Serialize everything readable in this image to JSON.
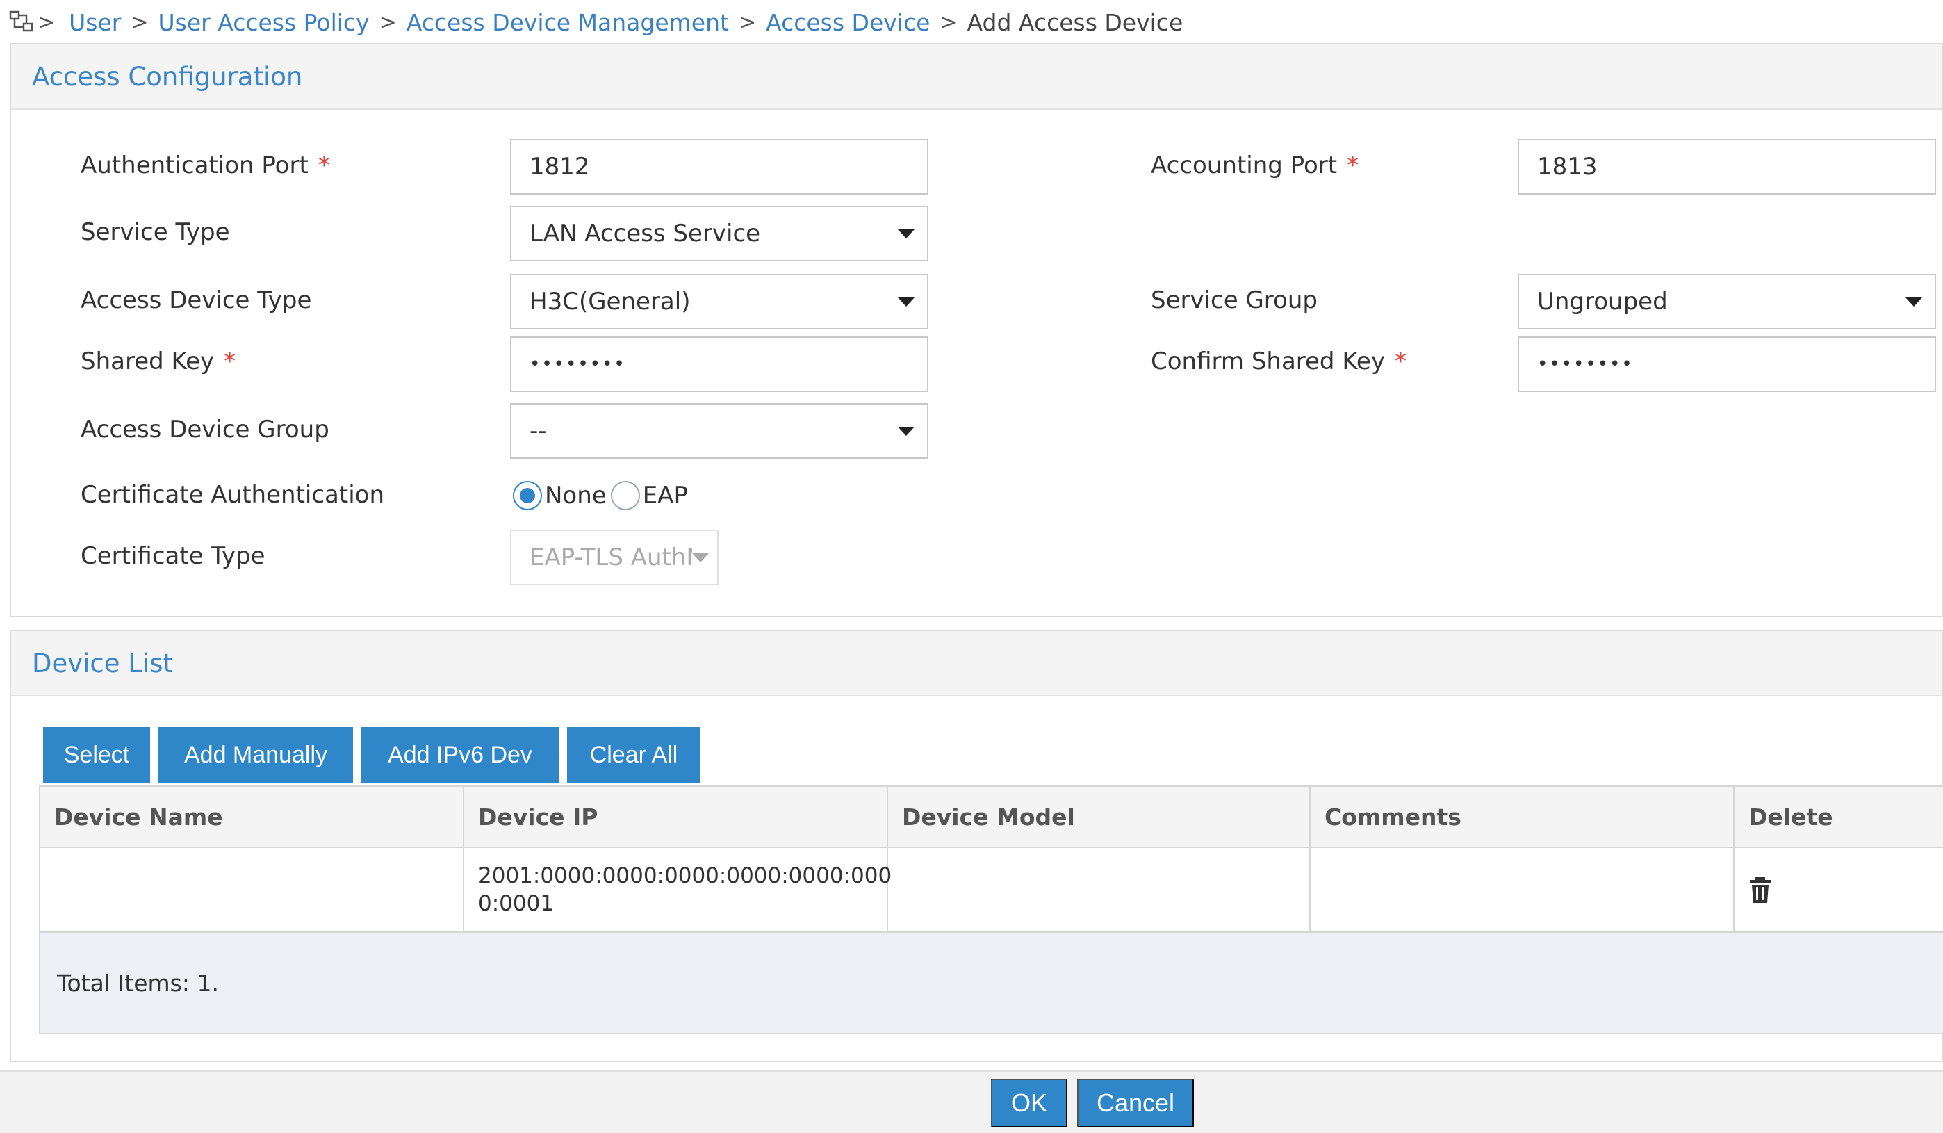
{
  "breadcrumb": {
    "items": [
      "User",
      "User Access Policy",
      "Access Device Management",
      "Access Device"
    ],
    "current": "Add Access Device",
    "separator": ">"
  },
  "access_config": {
    "title": "Access Configuration",
    "auth_port": {
      "label": "Authentication Port",
      "value": "1812",
      "required": "*"
    },
    "acct_port": {
      "label": "Accounting Port",
      "value": "1813",
      "required": "*"
    },
    "service_type": {
      "label": "Service Type",
      "value": "LAN Access Service"
    },
    "device_type": {
      "label": "Access Device Type",
      "value": "H3C(General)"
    },
    "service_group": {
      "label": "Service Group",
      "value": "Ungrouped"
    },
    "shared_key": {
      "label": "Shared Key",
      "value": "••••••••",
      "required": "*"
    },
    "confirm_key": {
      "label": "Confirm Shared Key",
      "value": "••••••••",
      "required": "*"
    },
    "device_group": {
      "label": "Access Device Group",
      "value": "--"
    },
    "cert_auth": {
      "label": "Certificate Authentication",
      "options": [
        "None",
        "EAP"
      ],
      "selected": "None"
    },
    "cert_type": {
      "label": "Certificate Type",
      "value": "EAP-TLS AuthN"
    }
  },
  "device_list": {
    "title": "Device List",
    "buttons": [
      "Select",
      "Add Manually",
      "Add IPv6 Dev",
      "Clear All"
    ],
    "columns": [
      "Device Name",
      "Device IP",
      "Device Model",
      "Comments",
      "Delete"
    ],
    "rows": [
      {
        "name": "",
        "ip_line1": "2001:0000:0000:0000:0000:0000:000",
        "ip_line2": "0:0001",
        "model": "",
        "comments": "",
        "delete_icon": "trash-icon"
      }
    ],
    "total": "Total Items: 1."
  },
  "actions": {
    "ok": "OK",
    "cancel": "Cancel"
  },
  "colors": {
    "accent": "#2f86c8",
    "link": "#3a7fc1",
    "required": "#e0453b"
  }
}
